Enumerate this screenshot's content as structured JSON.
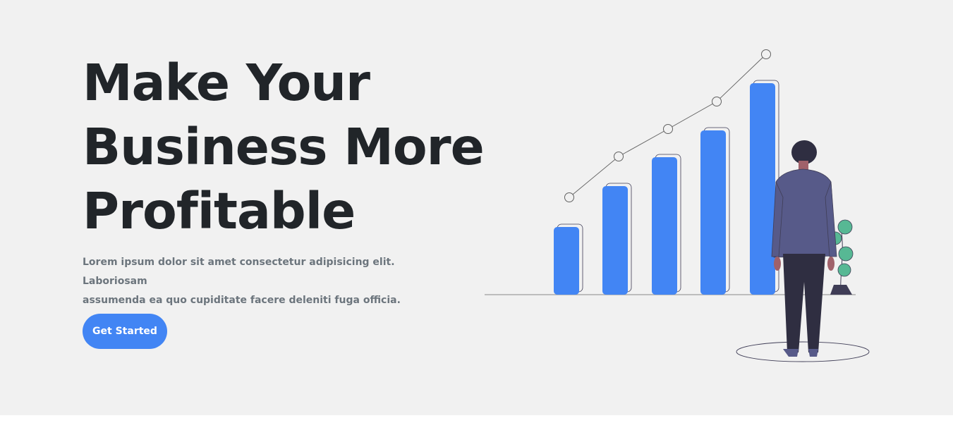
{
  "hero": {
    "headline_lines": [
      "Make Your",
      "Business More",
      "Profitable"
    ],
    "lead_line1": "Lorem ipsum dolor sit amet consectetur adipisicing elit. Laboriosam",
    "lead_line2": "assumenda ea quo cupiditate facere deleniti fuga officia.",
    "cta_label": "Get Started"
  },
  "colors": {
    "page_bg": "#f1f1f1",
    "heading": "#212529",
    "lead_text": "#6c757d",
    "accent": "#4285f4",
    "suit": "#575a89",
    "trousers": "#2f2e41",
    "plant": "#57b894"
  },
  "illustration": {
    "icon": "business-growth-illustration",
    "bar_count": 5
  }
}
